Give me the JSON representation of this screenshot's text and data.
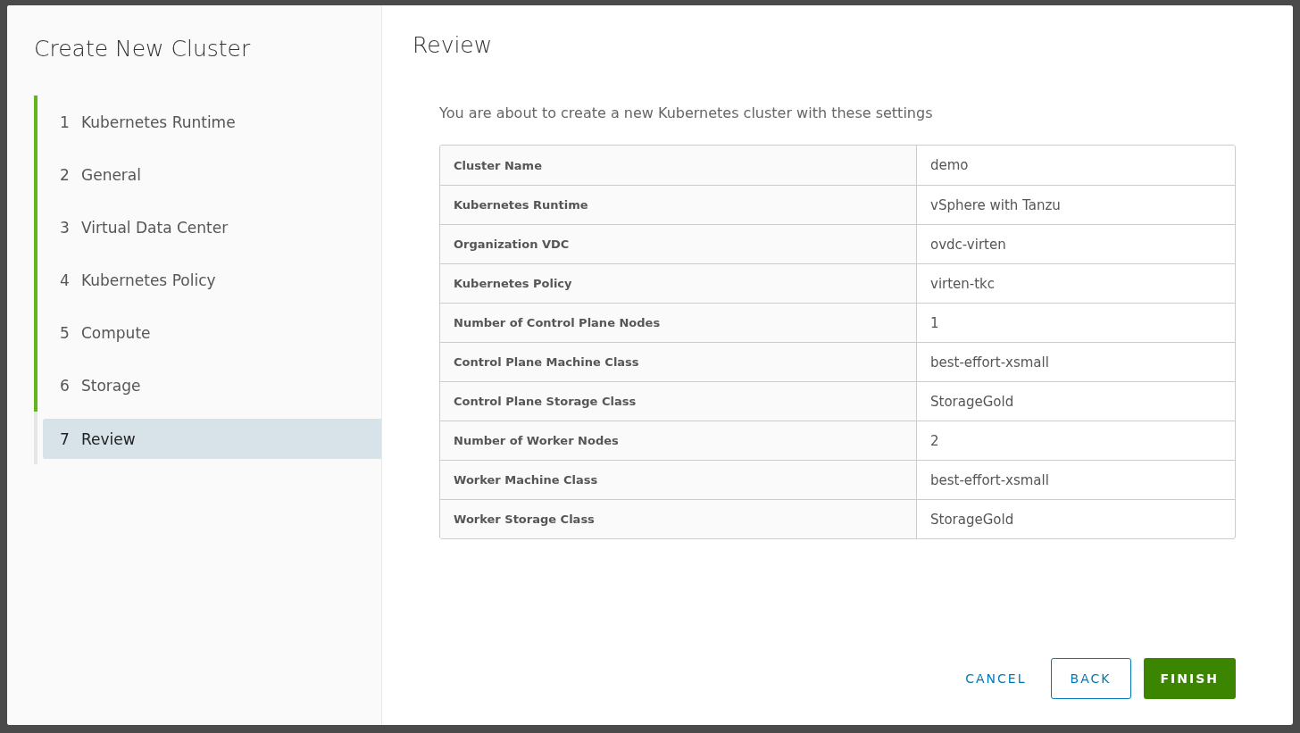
{
  "wizard": {
    "title": "Create New Cluster",
    "steps": [
      {
        "number": "1",
        "label": "Kubernetes Runtime",
        "completed": true,
        "selected": false
      },
      {
        "number": "2",
        "label": "General",
        "completed": true,
        "selected": false
      },
      {
        "number": "3",
        "label": "Virtual Data Center",
        "completed": true,
        "selected": false
      },
      {
        "number": "4",
        "label": "Kubernetes Policy",
        "completed": true,
        "selected": false
      },
      {
        "number": "5",
        "label": "Compute",
        "completed": true,
        "selected": false
      },
      {
        "number": "6",
        "label": "Storage",
        "completed": true,
        "selected": false
      },
      {
        "number": "7",
        "label": "Review",
        "completed": false,
        "selected": true
      }
    ]
  },
  "page": {
    "title": "Review",
    "intro": "You are about to create a new Kubernetes cluster with these settings",
    "settings": [
      {
        "name": "Cluster Name",
        "value": "demo"
      },
      {
        "name": "Kubernetes Runtime",
        "value": "vSphere with Tanzu"
      },
      {
        "name": "Organization VDC",
        "value": "ovdc-virten"
      },
      {
        "name": "Kubernetes Policy",
        "value": "virten-tkc"
      },
      {
        "name": "Number of Control Plane Nodes",
        "value": "1"
      },
      {
        "name": "Control Plane Machine Class",
        "value": "best-effort-xsmall"
      },
      {
        "name": "Control Plane Storage Class",
        "value": "StorageGold"
      },
      {
        "name": "Number of Worker Nodes",
        "value": "2"
      },
      {
        "name": "Worker Machine Class",
        "value": "best-effort-xsmall"
      },
      {
        "name": "Worker Storage Class",
        "value": "StorageGold"
      }
    ]
  },
  "buttons": [
    {
      "label": "CANCEL",
      "kind": "link"
    },
    {
      "label": "BACK",
      "kind": "outline"
    },
    {
      "label": "FINISH",
      "kind": "primary"
    }
  ]
}
